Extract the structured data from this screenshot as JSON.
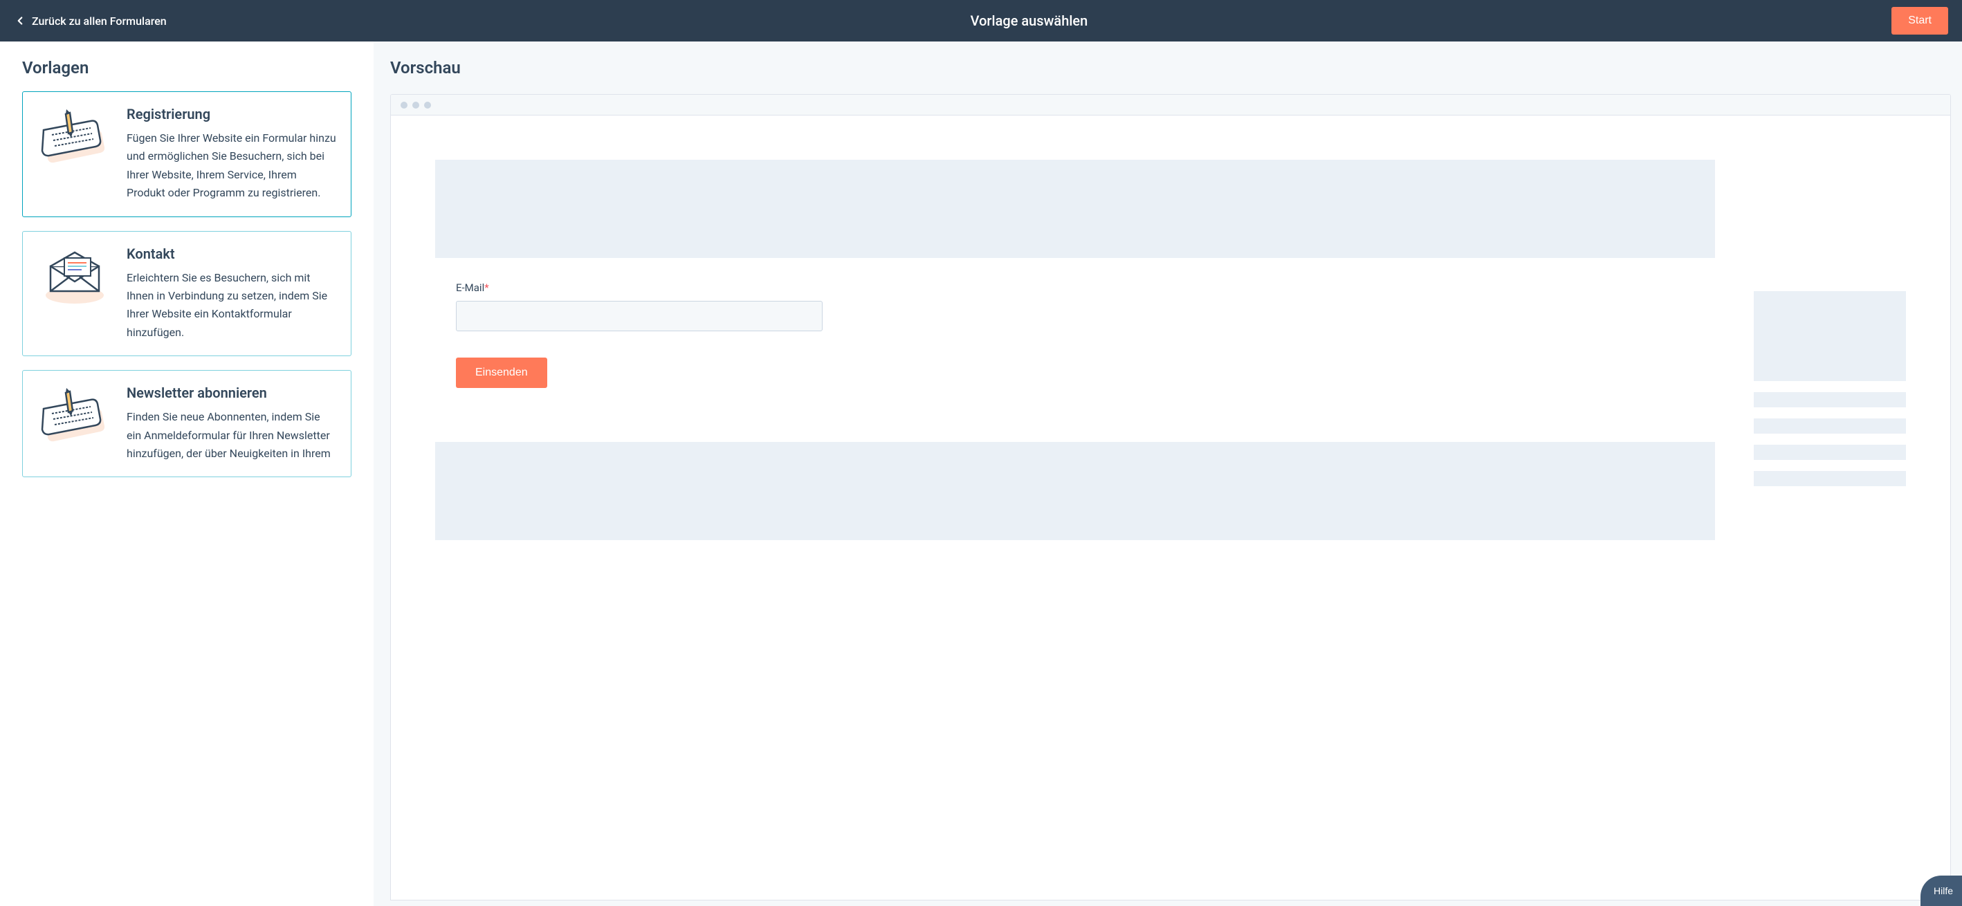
{
  "header": {
    "back_label": "Zurück zu allen Formularen",
    "title": "Vorlage auswählen",
    "start_label": "Start"
  },
  "left": {
    "heading": "Vorlagen",
    "templates": [
      {
        "title": "Registrierung",
        "desc": "Fügen Sie Ihrer Website ein Formular hinzu und ermöglichen Sie Besuchern, sich bei Ihrer Website, Ihrem Service, Ihrem Produkt oder Programm zu registrieren."
      },
      {
        "title": "Kontakt",
        "desc": "Erleichtern Sie es Besuchern, sich mit Ihnen in Verbindung zu setzen, indem Sie Ihrer Website ein Kontaktformular hinzufügen."
      },
      {
        "title": "Newsletter abonnieren",
        "desc": "Finden Sie neue Abonnenten, indem Sie ein Anmeldeformular für Ihren Newsletter hinzufügen, der über Neuigkeiten in Ihrem"
      }
    ]
  },
  "right": {
    "heading": "Vorschau",
    "form": {
      "email_label": "E-Mail",
      "submit_label": "Einsenden"
    }
  },
  "help_label": "Hilfe"
}
